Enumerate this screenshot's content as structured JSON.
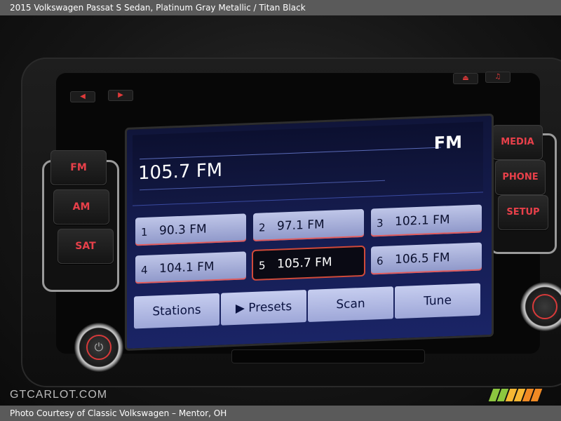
{
  "header": {
    "caption": "2015 Volkswagen Passat S Sedan,  Platinum Gray Metallic / Titan Black"
  },
  "footer": {
    "caption": "Photo Courtesy of Classic Volkswagen – Mentor, OH"
  },
  "watermark": {
    "text": "GTCARLOT.COM"
  },
  "radio": {
    "current_frequency": "105.7 FM",
    "band": "FM",
    "presets": [
      {
        "num": "1",
        "label": "90.3 FM"
      },
      {
        "num": "2",
        "label": "97.1 FM"
      },
      {
        "num": "3",
        "label": "102.1 FM"
      },
      {
        "num": "4",
        "label": "104.1 FM"
      },
      {
        "num": "5",
        "label": "105.7 FM"
      },
      {
        "num": "6",
        "label": "106.5 FM"
      }
    ],
    "active_preset": 5,
    "buttons": {
      "stations": "Stations",
      "presets": "▶ Presets",
      "scan": "Scan",
      "tune": "Tune"
    }
  },
  "hardware": {
    "left": {
      "fm": "FM",
      "am": "AM",
      "sat": "SAT"
    },
    "right": {
      "media": "MEDIA",
      "phone": "PHONE",
      "setup": "SETUP"
    },
    "top": {
      "prev": "◀",
      "next": "▶",
      "eject": "⏏",
      "music": "♫"
    }
  },
  "colors": {
    "accent_red": "#e8404a",
    "screen_blue": "#1a2466",
    "preset_fill": "#bfc6e8"
  }
}
